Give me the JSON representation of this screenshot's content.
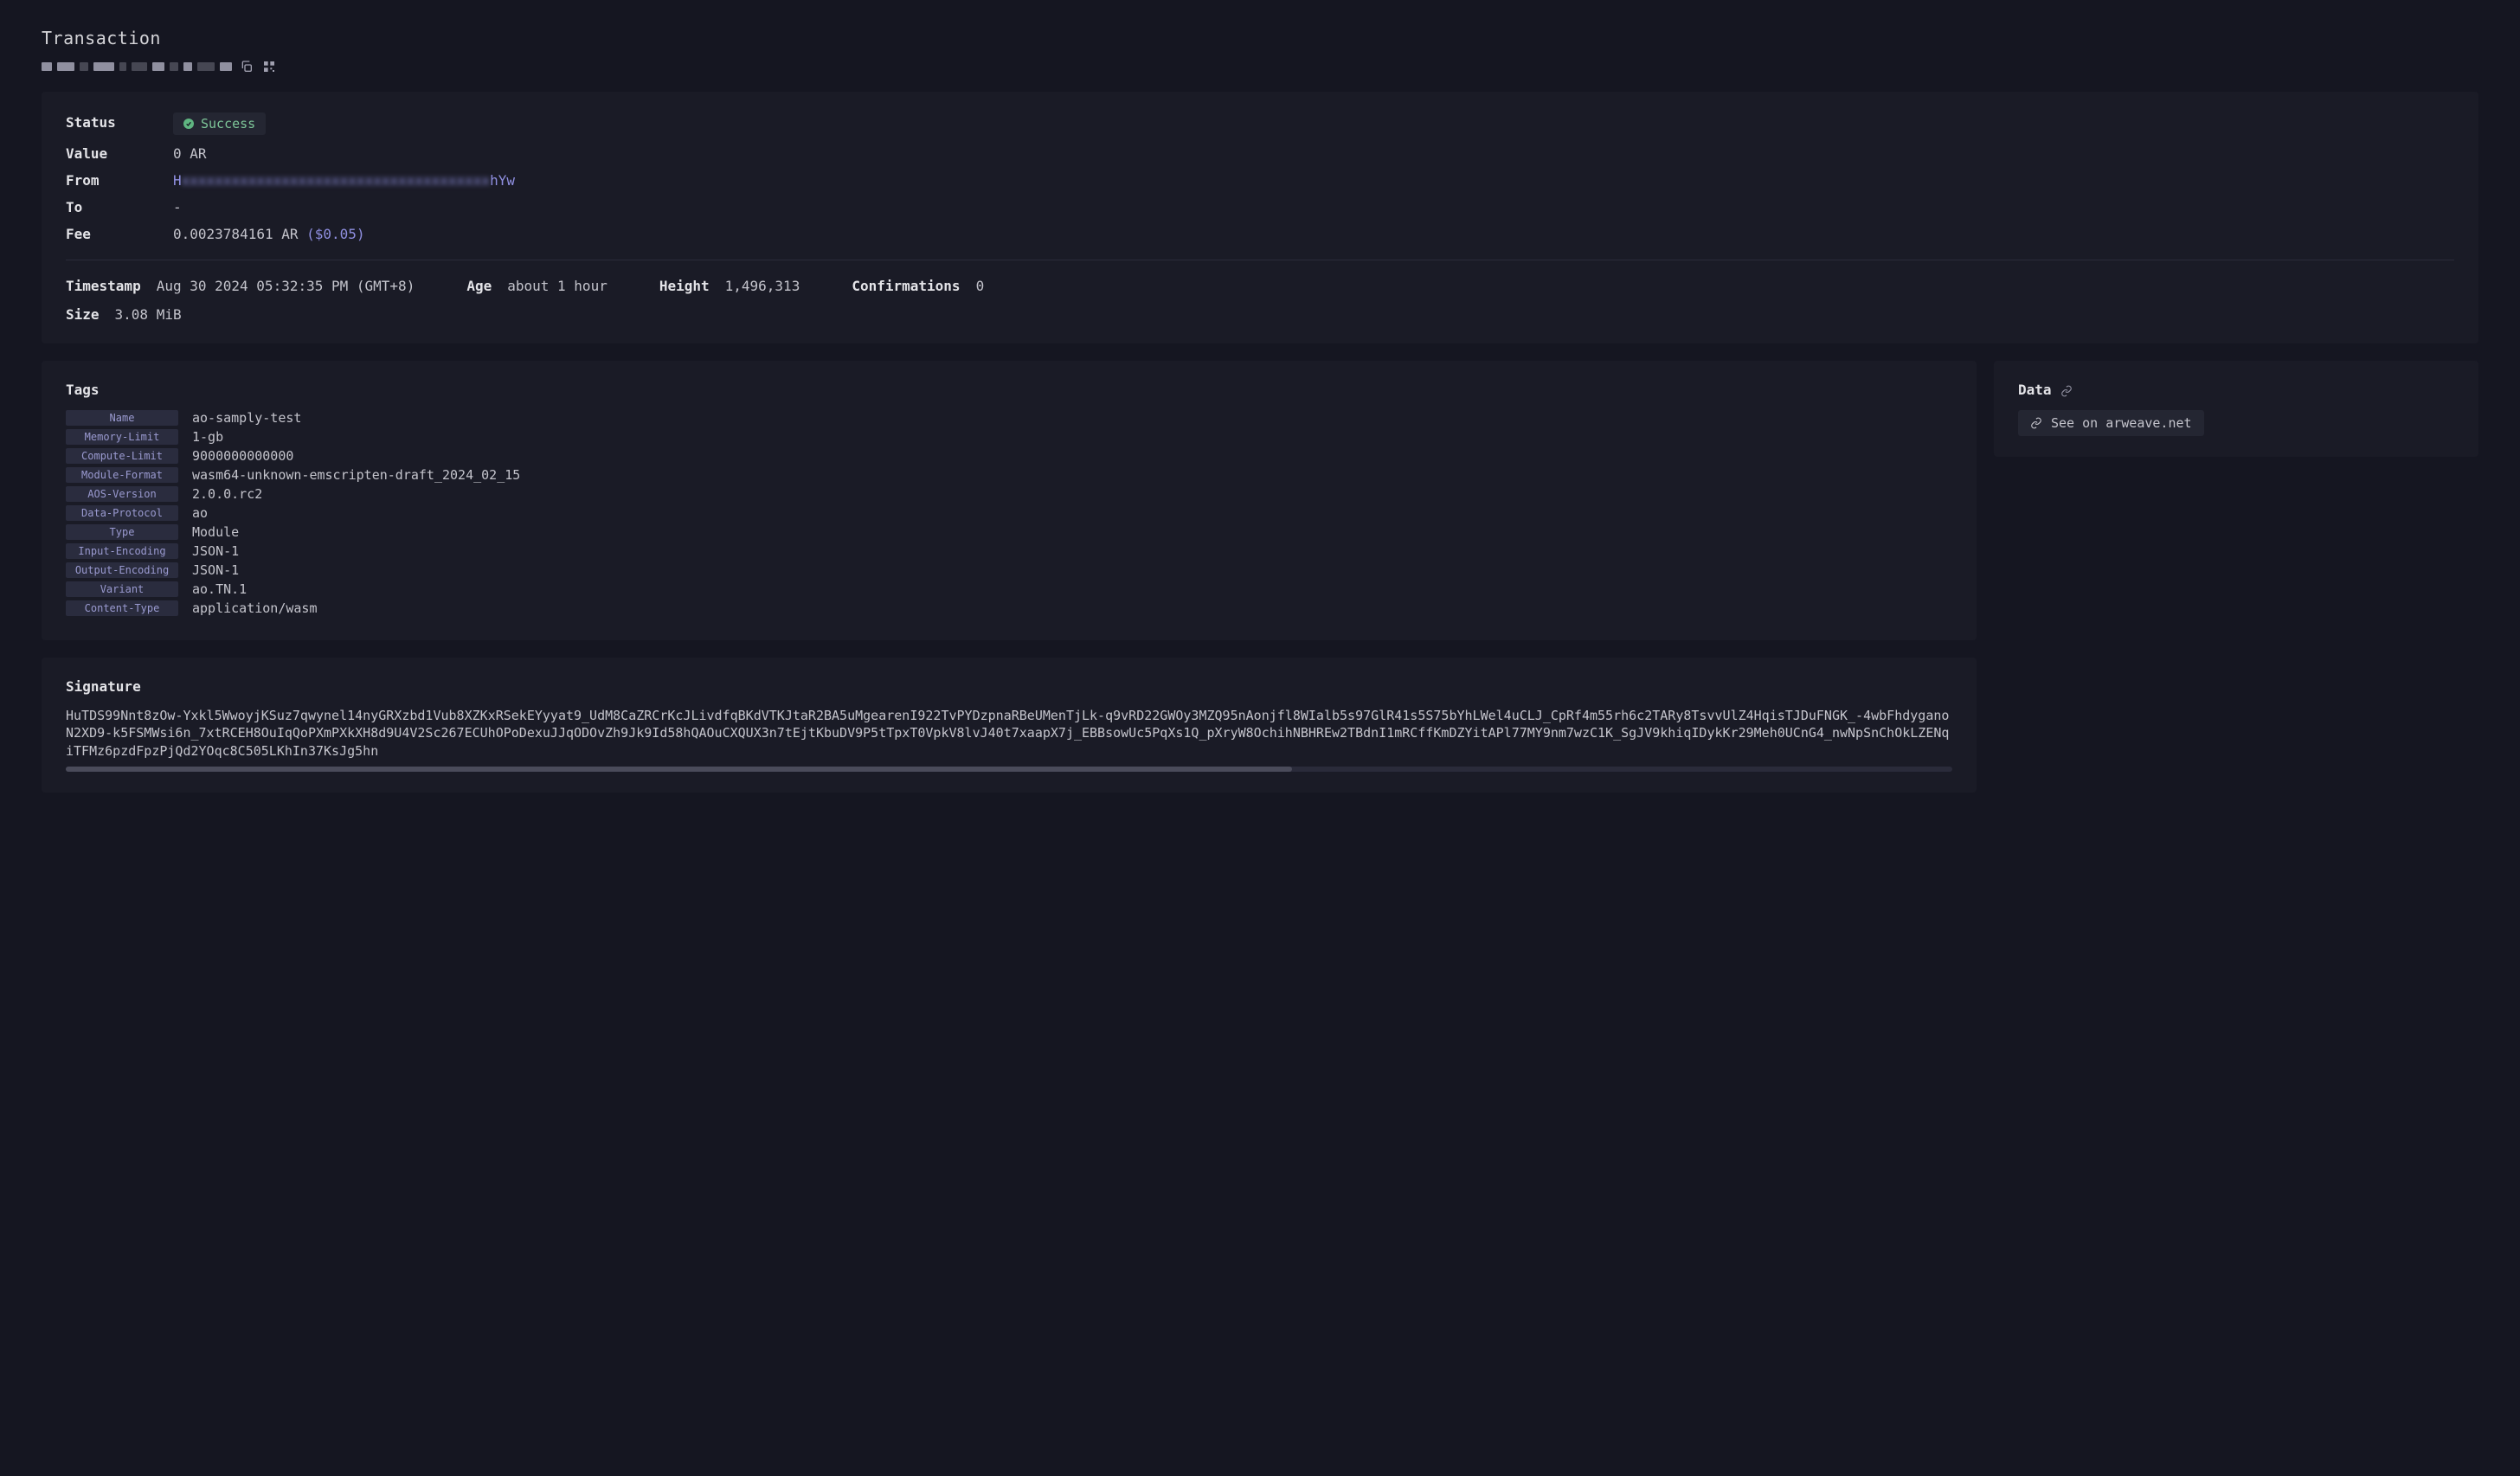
{
  "page_title": "Transaction",
  "summary": {
    "status_label": "Status",
    "status_value": "Success",
    "value_label": "Value",
    "value_value": "0 AR",
    "from_label": "From",
    "from_value": "H▓▓▓▓▓▓▓▓▓▓▓▓▓▓▓▓▓▓▓▓▓▓▓▓▓▓▓▓▓▓▓▓▓▓▓▓▓▓▓hYw",
    "to_label": "To",
    "to_value": "-",
    "fee_label": "Fee",
    "fee_value": "0.0023784161 AR",
    "fee_usd": "($0.05)"
  },
  "meta": {
    "timestamp_label": "Timestamp",
    "timestamp_value": "Aug 30 2024 05:32:35 PM (GMT+8)",
    "age_label": "Age",
    "age_value": "about 1 hour",
    "height_label": "Height",
    "height_value": "1,496,313",
    "confirmations_label": "Confirmations",
    "confirmations_value": "0",
    "size_label": "Size",
    "size_value": "3.08 MiB"
  },
  "tags": {
    "title": "Tags",
    "items": [
      {
        "key": "Name",
        "value": "ao-samply-test"
      },
      {
        "key": "Memory-Limit",
        "value": "1-gb"
      },
      {
        "key": "Compute-Limit",
        "value": "9000000000000"
      },
      {
        "key": "Module-Format",
        "value": "wasm64-unknown-emscripten-draft_2024_02_15"
      },
      {
        "key": "AOS-Version",
        "value": "2.0.0.rc2"
      },
      {
        "key": "Data-Protocol",
        "value": "ao"
      },
      {
        "key": "Type",
        "value": "Module"
      },
      {
        "key": "Input-Encoding",
        "value": "JSON-1"
      },
      {
        "key": "Output-Encoding",
        "value": "JSON-1"
      },
      {
        "key": "Variant",
        "value": "ao.TN.1"
      },
      {
        "key": "Content-Type",
        "value": "application/wasm"
      }
    ]
  },
  "data": {
    "title": "Data",
    "link_label": "See on arweave.net"
  },
  "signature": {
    "title": "Signature",
    "value": "HuTDS99Nnt8zOw-Yxkl5WwoyjKSuz7qwynel14nyGRXzbd1Vub8XZKxRSekEYyyat9_UdM8CaZRCrKcJLivdfqBKdVTKJtaR2BA5uMgearenI922TvPYDzpnaRBeUMenTjLk-q9vRD22GWOy3MZQ95nAonjfl8WIalb5s97GlR41s5S75bYhLWel4uCLJ_CpRf4m55rh6c2TARy8TsvvUlZ4HqisTJDuFNGK_-4wbFhdyganoN2XD9-k5FSMWsi6n_7xtRCEH8OuIqQoPXmPXkXH8d9U4V2Sc267ECUhOPoDexuJJqODOvZh9Jk9Id58hQAOuCXQUX3n7tEjtKbuDV9P5tTpxT0VpkV8lvJ40t7xaapX7j_EBBsowUc5PqXs1Q_pXryW8OchihNBHREw2TBdnI1mRCffKmDZYitAPl77MY9nm7wzC1K_SgJV9khiqIDykKr29Meh0UCnG4_nwNpSnChOkLZENqiTFMz6pzdFpzPjQd2YOqc8C505LKhIn37KsJg5hn"
  }
}
